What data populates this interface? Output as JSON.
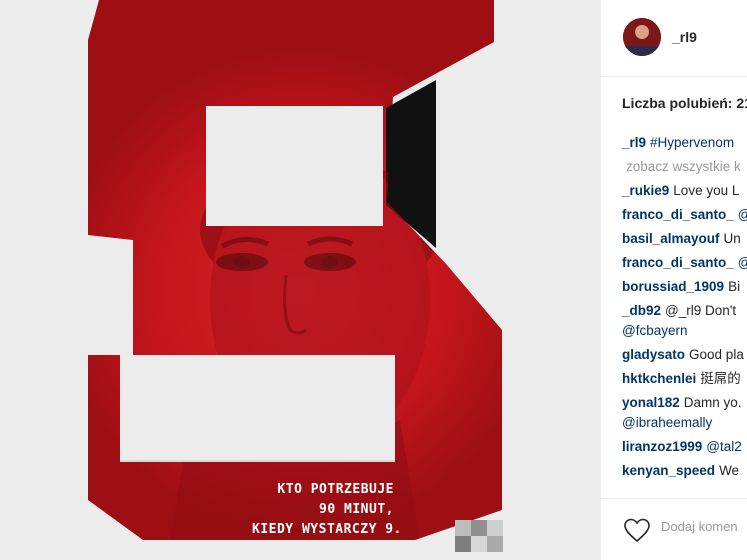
{
  "poster": {
    "caption_lines": [
      "KTO POTRZEBUJE",
      "90 MINUT,",
      "KIEDY WYSTARCZY 9."
    ]
  },
  "post": {
    "username": "_rl9",
    "likes": "Liczba polubień: 21",
    "caption": {
      "user": "_rl9",
      "text": "#Hypervenom"
    },
    "view_all": "zobacz wszystkie k",
    "comments": [
      {
        "user": "_rukie9",
        "text": "Love you L"
      },
      {
        "user": "franco_di_santo_",
        "text": "@"
      },
      {
        "user": "basil_almayouf",
        "text": "Un"
      },
      {
        "user": "franco_di_santo_",
        "text": "@"
      },
      {
        "user": "borussiad_1909",
        "text": "Bi"
      },
      {
        "user": "_db92",
        "text": "@_rl9 Don't",
        "text2": "@fcbayern"
      },
      {
        "user": "gladysato",
        "text": "Good pla"
      },
      {
        "user": "hktkchenlei",
        "text": "挺屌的"
      },
      {
        "user": "yonal182",
        "text": "Damn yo.",
        "text2": "@ibraheemally"
      },
      {
        "user": "liranzoz1999",
        "text": "@tal2"
      },
      {
        "user": "kenyan_speed",
        "text": "We"
      }
    ],
    "add_comment_placeholder": "Dodaj komen"
  },
  "colors": {
    "accent_red": "#c4161c",
    "link": "#003569"
  }
}
